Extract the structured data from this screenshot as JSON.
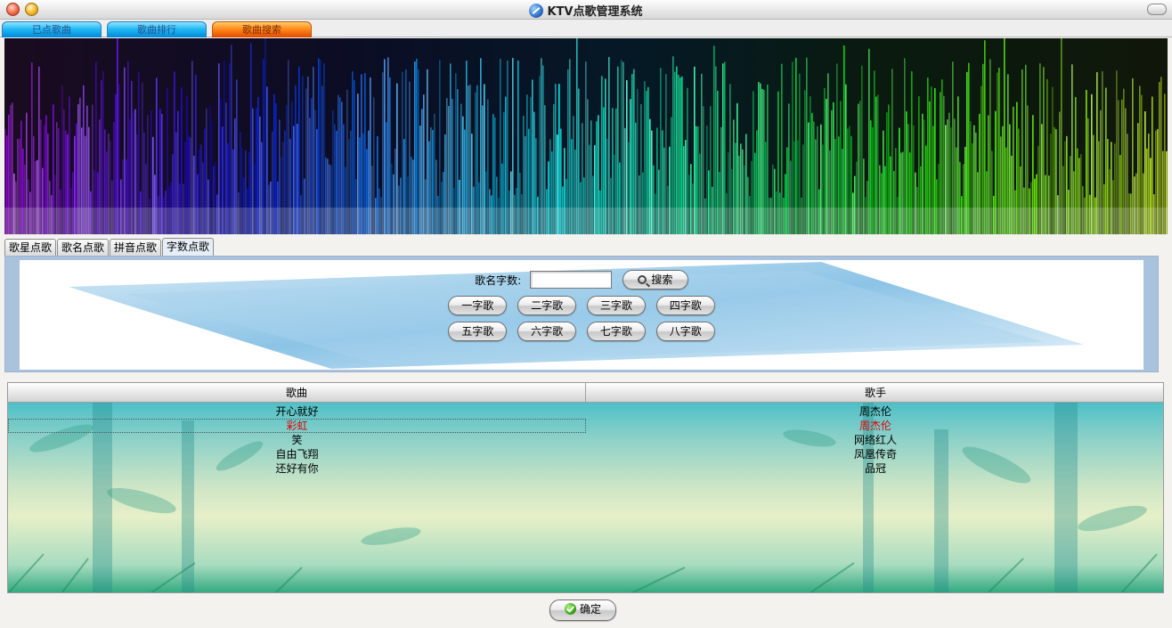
{
  "window": {
    "title": "KTV点歌管理系统"
  },
  "top_tabs": [
    {
      "label": "已点歌曲"
    },
    {
      "label": "歌曲排行"
    },
    {
      "label": "歌曲搜索",
      "active": true
    }
  ],
  "sub_tabs": [
    {
      "label": "歌星点歌"
    },
    {
      "label": "歌名点歌"
    },
    {
      "label": "拼音点歌"
    },
    {
      "label": "字数点歌",
      "active": true
    }
  ],
  "search": {
    "label": "歌名字数:",
    "value": "",
    "button_label": "搜索"
  },
  "count_buttons_row1": [
    "一字歌",
    "二字歌",
    "三字歌",
    "四字歌"
  ],
  "count_buttons_row2": [
    "五字歌",
    "六字歌",
    "七字歌",
    "八字歌"
  ],
  "table": {
    "columns": [
      "歌曲",
      "歌手"
    ],
    "rows": [
      {
        "song": "开心就好",
        "singer": "周杰伦"
      },
      {
        "song": "彩虹",
        "singer": "周杰伦",
        "selected": true
      },
      {
        "song": "笑",
        "singer": "网络红人"
      },
      {
        "song": "自由飞翔",
        "singer": "凤凰传奇"
      },
      {
        "song": "还好有你",
        "singer": "品冠"
      }
    ]
  },
  "confirm_label": "确定",
  "colors": {
    "selected_text": "#e00000",
    "active_tab": "#ff8a1a",
    "tab": "#22b9f5"
  }
}
